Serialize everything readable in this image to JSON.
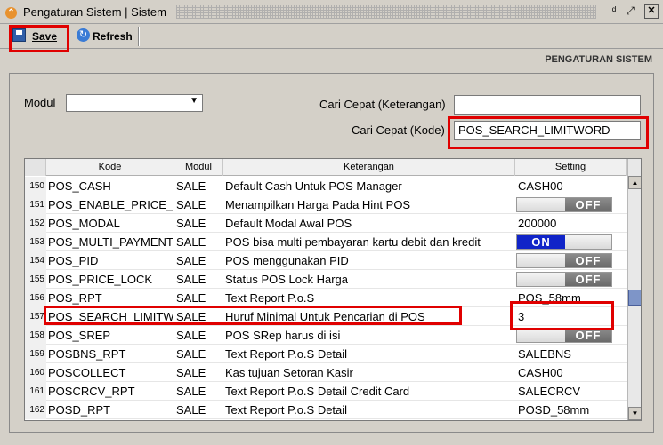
{
  "window": {
    "title": "Pengaturan Sistem | Sistem",
    "minimize_glyph": "ᵈ",
    "maximize_glyph": "⤢",
    "close_glyph": "✕"
  },
  "toolbar": {
    "save_label": "Save",
    "refresh_label": "Refresh"
  },
  "header": {
    "section_title": "PENGATURAN SISTEM"
  },
  "filters": {
    "modul_label": "Modul",
    "modul_value": "",
    "search_desc_label": "Cari Cepat (Keterangan)",
    "search_desc_value": "",
    "search_code_label": "Cari Cepat (Kode)",
    "search_code_value": "POS_SEARCH_LIMITWORD"
  },
  "grid": {
    "columns": [
      "Kode",
      "Modul",
      "Keterangan",
      "Setting"
    ],
    "rows": [
      {
        "no": "150",
        "kode": "POS_CASH",
        "modul": "SALE",
        "ket": "Default Cash Untuk POS Manager",
        "setting": "CASH00",
        "type": "text"
      },
      {
        "no": "151",
        "kode": "POS_ENABLE_PRICE_",
        "modul": "SALE",
        "ket": "Menampilkan Harga Pada Hint POS",
        "setting": "OFF",
        "type": "off"
      },
      {
        "no": "152",
        "kode": "POS_MODAL",
        "modul": "SALE",
        "ket": "Default Modal Awal POS",
        "setting": "200000",
        "type": "text"
      },
      {
        "no": "153",
        "kode": "POS_MULTI_PAYMENT",
        "modul": "SALE",
        "ket": "POS bisa multi pembayaran kartu debit dan kredit",
        "setting": "ON",
        "type": "on"
      },
      {
        "no": "154",
        "kode": "POS_PID",
        "modul": "SALE",
        "ket": "POS menggunakan PID",
        "setting": "OFF",
        "type": "off"
      },
      {
        "no": "155",
        "kode": "POS_PRICE_LOCK",
        "modul": "SALE",
        "ket": "Status POS Lock Harga",
        "setting": "OFF",
        "type": "off"
      },
      {
        "no": "156",
        "kode": "POS_RPT",
        "modul": "SALE",
        "ket": "Text Report P.o.S",
        "setting": "POS_58mm",
        "type": "text"
      },
      {
        "no": "157",
        "kode": "POS_SEARCH_LIMITW",
        "modul": "SALE",
        "ket": "Huruf Minimal Untuk Pencarian di POS",
        "setting": "3",
        "type": "text"
      },
      {
        "no": "158",
        "kode": "POS_SREP",
        "modul": "SALE",
        "ket": "POS SRep harus di isi",
        "setting": "OFF",
        "type": "off"
      },
      {
        "no": "159",
        "kode": "POSBNS_RPT",
        "modul": "SALE",
        "ket": "Text Report P.o.S Detail",
        "setting": "SALEBNS",
        "type": "text"
      },
      {
        "no": "160",
        "kode": "POSCOLLECT",
        "modul": "SALE",
        "ket": "Kas tujuan Setoran Kasir",
        "setting": "CASH00",
        "type": "text"
      },
      {
        "no": "161",
        "kode": "POSCRCV_RPT",
        "modul": "SALE",
        "ket": "Text Report P.o.S Detail Credit Card",
        "setting": "SALECRCV",
        "type": "text"
      },
      {
        "no": "162",
        "kode": "POSD_RPT",
        "modul": "SALE",
        "ket": "Text Report P.o.S Detail",
        "setting": "POSD_58mm",
        "type": "text"
      }
    ]
  },
  "colors": {
    "highlight": "#e00000",
    "on_toggle": "#1024c8",
    "off_knob": "#7a7a7a"
  }
}
